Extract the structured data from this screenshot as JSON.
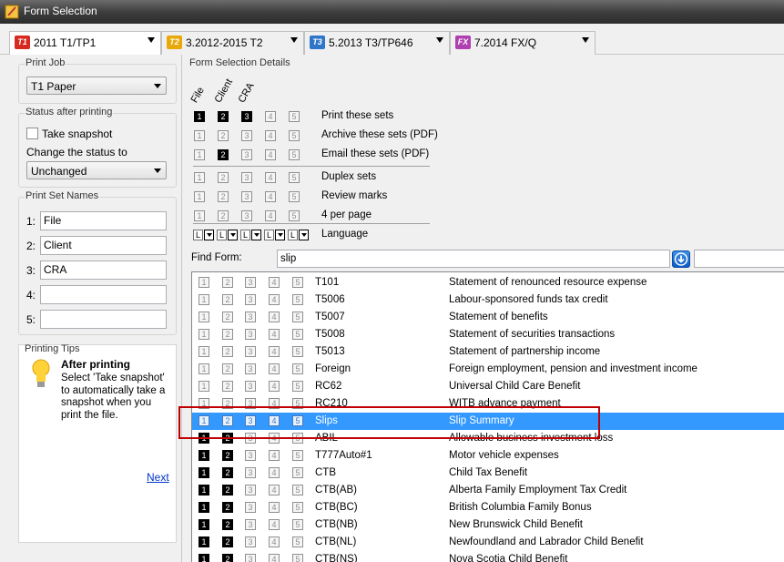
{
  "window": {
    "title": "Form Selection"
  },
  "tabs": [
    {
      "icon": "T1",
      "label": "2011 T1/TP1",
      "color": "#d72a20",
      "active": true
    },
    {
      "icon": "T2",
      "label": "3.2012-2015 T2",
      "color": "#e8a90a",
      "active": false
    },
    {
      "icon": "T3",
      "label": "5.2013 T3/TP646",
      "color": "#2f75c9",
      "active": false
    },
    {
      "icon": "FX",
      "label": "7.2014 FX/Q",
      "color": "#b03fb0",
      "active": false
    }
  ],
  "print_job": {
    "title": "Print Job",
    "value": "T1 Paper"
  },
  "status_after": {
    "title": "Status after printing",
    "snapshot_label": "Take snapshot",
    "change_label": "Change the status to",
    "status_value": "Unchanged"
  },
  "print_set_names": {
    "title": "Print Set Names",
    "sets": [
      {
        "num": "1:",
        "value": "File"
      },
      {
        "num": "2:",
        "value": "Client"
      },
      {
        "num": "3:",
        "value": "CRA"
      },
      {
        "num": "4:",
        "value": ""
      },
      {
        "num": "5:",
        "value": ""
      }
    ]
  },
  "tips": {
    "title": "Printing Tips",
    "heading": "After printing",
    "body": "Select 'Take snapshot' to automatically take a snapshot when you print the file.",
    "next": "Next"
  },
  "details": {
    "title": "Form Selection Details",
    "col_heads": [
      "File",
      "Client",
      "CRA"
    ],
    "options": [
      {
        "label": "Print these sets",
        "on": [
          1,
          2,
          3
        ]
      },
      {
        "label": "Archive these sets (PDF)",
        "on": []
      },
      {
        "label": "Email these sets (PDF)",
        "on": [
          2
        ]
      },
      {
        "label": "Duplex sets",
        "on": []
      },
      {
        "label": "Review marks",
        "on": []
      },
      {
        "label": "4 per page",
        "on": []
      },
      {
        "label": "Language",
        "on": []
      }
    ],
    "lang_value": "L"
  },
  "find": {
    "label": "Find Form:",
    "value": "slip"
  },
  "forms": [
    {
      "code": "T101",
      "desc": "Statement of renounced resource expense",
      "on": []
    },
    {
      "code": "T5006",
      "desc": "Labour-sponsored funds tax credit",
      "on": []
    },
    {
      "code": "T5007",
      "desc": "Statement of benefits",
      "on": []
    },
    {
      "code": "T5008",
      "desc": "Statement of securities transactions",
      "on": []
    },
    {
      "code": "T5013",
      "desc": "Statement of partnership income",
      "on": []
    },
    {
      "code": "Foreign",
      "desc": "Foreign employment, pension and investment income",
      "on": []
    },
    {
      "code": "RC62",
      "desc": "Universal Child Care Benefit",
      "on": []
    },
    {
      "code": "RC210",
      "desc": "WITB advance payment",
      "on": []
    },
    {
      "code": "Slips",
      "desc": "Slip Summary",
      "on": [],
      "selected": true
    },
    {
      "code": "ABIL",
      "desc": "Allowable business investment loss",
      "on": [
        1,
        2
      ]
    },
    {
      "code": "T777Auto#1",
      "desc": "Motor vehicle expenses",
      "on": [
        1,
        2
      ]
    },
    {
      "code": "CTB",
      "desc": "Child Tax Benefit",
      "on": [
        1,
        2
      ]
    },
    {
      "code": "CTB(AB)",
      "desc": "Alberta Family Employment Tax Credit",
      "on": [
        1,
        2
      ]
    },
    {
      "code": "CTB(BC)",
      "desc": "British Columbia Family Bonus",
      "on": [
        1,
        2
      ]
    },
    {
      "code": "CTB(NB)",
      "desc": "New Brunswick Child Benefit",
      "on": [
        1,
        2
      ]
    },
    {
      "code": "CTB(NL)",
      "desc": "Newfoundland and Labrador Child Benefit",
      "on": [
        1,
        2
      ]
    },
    {
      "code": "CTB(NS)",
      "desc": "Nova Scotia Child Benefit",
      "on": [
        1,
        2
      ]
    }
  ]
}
